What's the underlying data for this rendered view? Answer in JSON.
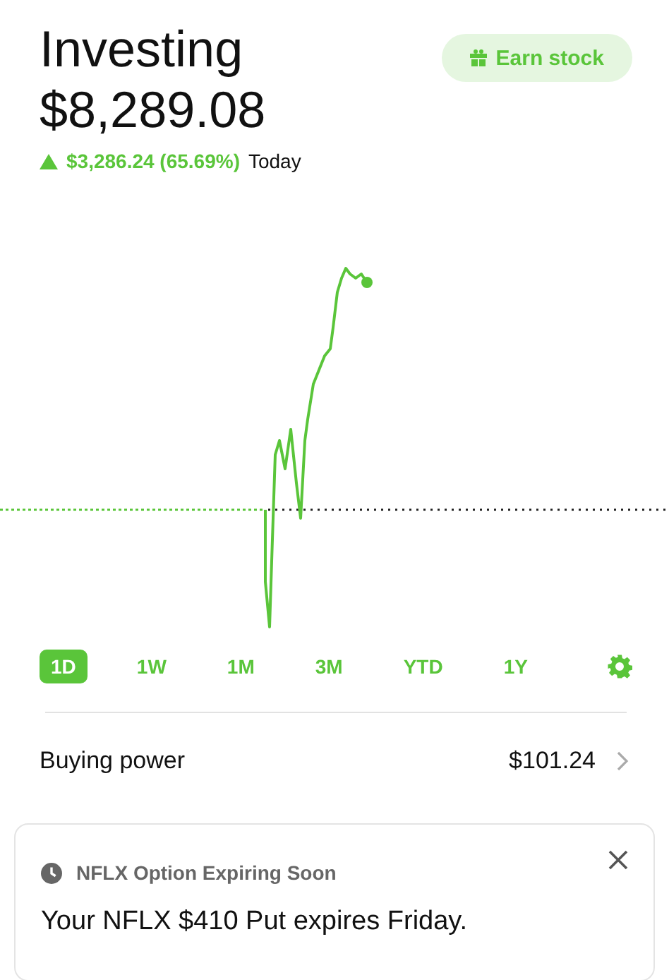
{
  "header": {
    "title": "Investing",
    "value": "$8,289.08",
    "change": "$3,286.24 (65.69%)",
    "change_period": "Today",
    "earn_button": "Earn stock"
  },
  "ranges": [
    {
      "label": "1D",
      "selected": true
    },
    {
      "label": "1W",
      "selected": false
    },
    {
      "label": "1M",
      "selected": false
    },
    {
      "label": "3M",
      "selected": false
    },
    {
      "label": "YTD",
      "selected": false
    },
    {
      "label": "1Y",
      "selected": false
    }
  ],
  "buying_power": {
    "label": "Buying power",
    "value": "$101.24"
  },
  "notification": {
    "title": "NFLX Option Expiring Soon",
    "message": "Your NFLX $410 Put expires Friday."
  }
}
